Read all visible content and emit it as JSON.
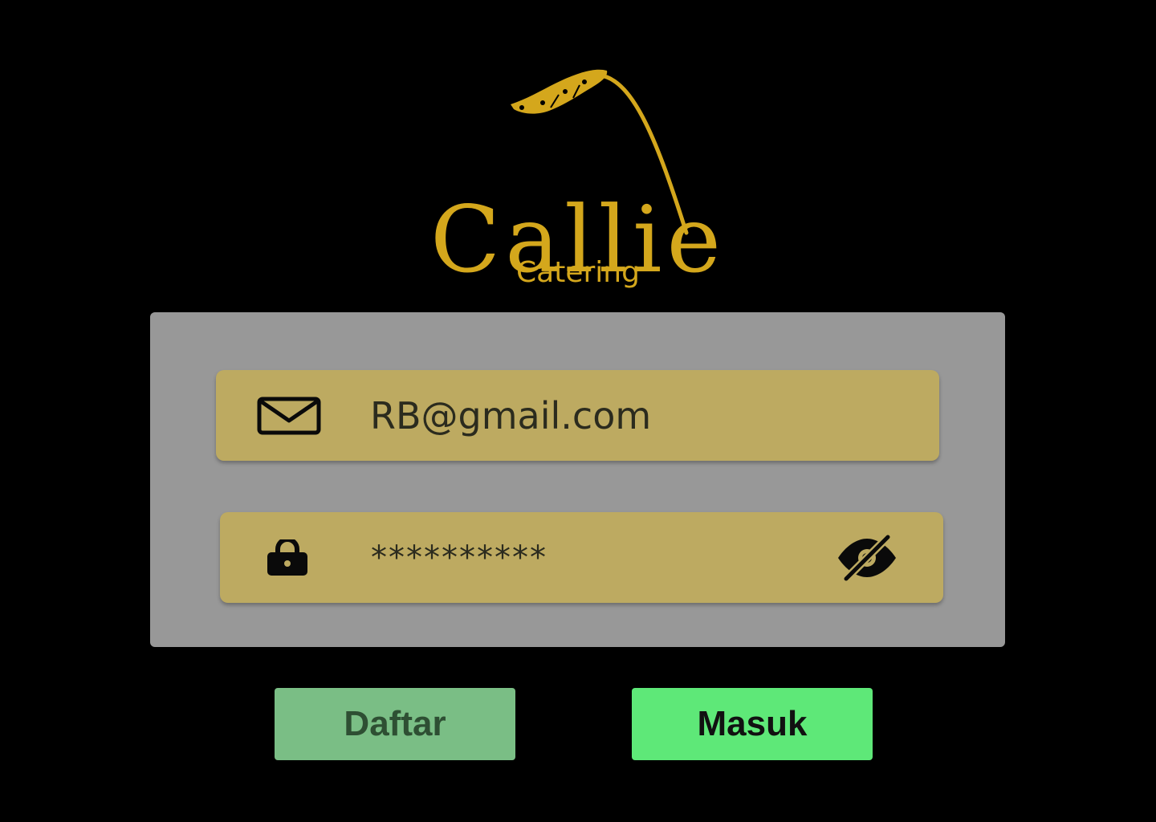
{
  "brand": {
    "name": "Callie",
    "tagline": "Catering",
    "color": "#D4A71C"
  },
  "login_form": {
    "email": {
      "icon": "mail-icon",
      "value": "RB@gmail.com"
    },
    "password": {
      "icon": "lock-icon",
      "value": "**********",
      "visibility_icon": "eye-off-icon"
    }
  },
  "actions": {
    "register_label": "Daftar",
    "login_label": "Masuk"
  },
  "colors": {
    "background": "#000000",
    "panel": "#989898",
    "field": "#BDAA61",
    "register_button": "#7ABE85",
    "login_button": "#5EE878"
  }
}
